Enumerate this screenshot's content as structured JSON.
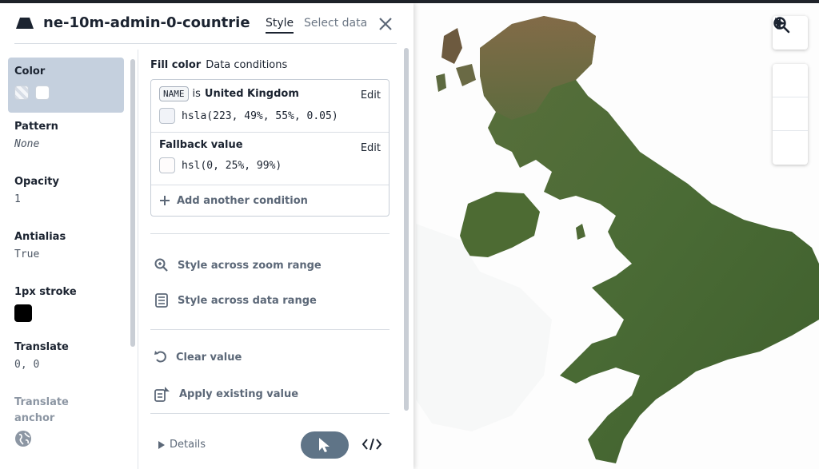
{
  "header": {
    "title": "ne-10m-admin-0-countrie...",
    "tabs": [
      {
        "label": "Style",
        "active": true
      },
      {
        "label": "Select data",
        "active": false
      }
    ]
  },
  "properties": [
    {
      "label": "Color",
      "value": "",
      "active": true
    },
    {
      "label": "Pattern",
      "value": "None"
    },
    {
      "label": "Opacity",
      "value": "1"
    },
    {
      "label": "Antialias",
      "value": "True"
    },
    {
      "label": "1px stroke",
      "value": ""
    },
    {
      "label": "Translate",
      "value": "0, 0"
    },
    {
      "label": "Translate anchor",
      "value": ""
    }
  ],
  "fill": {
    "heading": "Fill color",
    "subheading": "Data conditions",
    "conditions": [
      {
        "field": "NAME",
        "operator": "is",
        "value": "United Kingdom",
        "color": "hsla(223, 49%, 55%, 0.05)",
        "edit_label": "Edit"
      },
      {
        "label": "Fallback value",
        "color": "hsl(0, 25%, 99%)",
        "edit_label": "Edit"
      }
    ],
    "add_label": "Add another condition"
  },
  "actions": {
    "zoom": "Style across zoom range",
    "data_range": "Style across data range",
    "clear": "Clear value",
    "apply": "Apply existing value"
  },
  "footer": {
    "details_label": "Details"
  },
  "colors": {
    "active_prop_bg": "#c5d0de",
    "land_green": "#4a6b35",
    "highland_brown": "#8a6a4a",
    "stroke_swatch": "#000000",
    "pointer_button": "#5f7487"
  },
  "icons": [
    "layer-fill-icon",
    "close-icon",
    "search-icon",
    "zoom-in-icon",
    "zoom-out-icon",
    "compass-icon",
    "zoom-range-icon",
    "data-range-icon",
    "undo-icon",
    "apply-icon",
    "caret-right-icon",
    "cursor-icon",
    "code-icon",
    "globe-icon",
    "plus-icon"
  ]
}
